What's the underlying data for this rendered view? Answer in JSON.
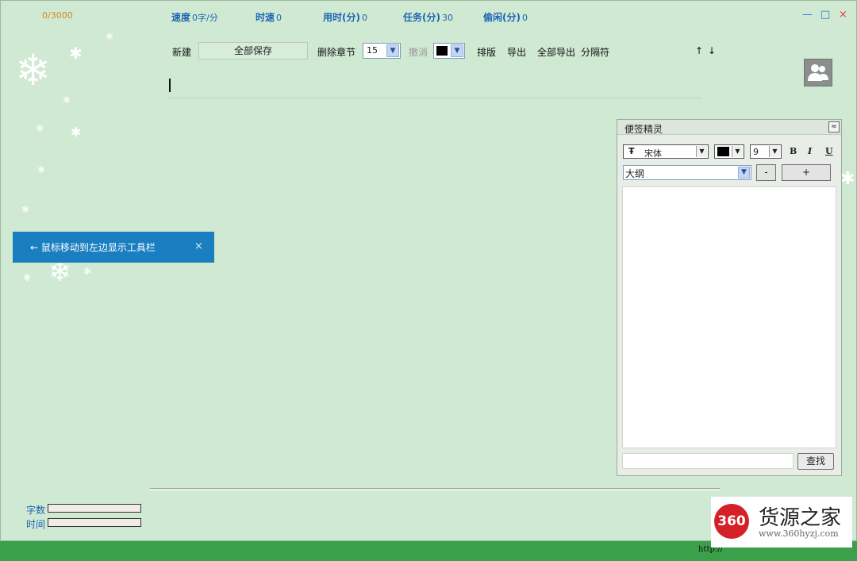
{
  "stats": {
    "word_count": "0/3000",
    "speed_label": "速度",
    "speed_value": "0字/分",
    "hour_speed_label": "时速",
    "hour_speed_value": "0",
    "time_used_label": "用时(分)",
    "time_used_value": "0",
    "task_label": "任务(分)",
    "task_value": "30",
    "idle_label": "偷闲(分)",
    "idle_value": "0"
  },
  "window_controls": {
    "minimize": "—",
    "maximize": "□",
    "close": "×"
  },
  "toolbar": {
    "new_label": "新建",
    "save_all_label": "全部保存",
    "delete_chapter_label": "删除章节",
    "chapter_number": "15",
    "undo_label": "撤消",
    "layout_label": "排版",
    "export_label": "导出",
    "export_all_label": "全部导出",
    "separator_label": "分隔符",
    "up_label": "↑",
    "down_label": "↓",
    "text_color": "#000000"
  },
  "hint": {
    "text": "← 鼠标移动到左边显示工具栏",
    "close": "×"
  },
  "notes_panel": {
    "title": "便签精灵",
    "collapse": "≈",
    "font_icon": "Ŧ",
    "font_name": "宋体",
    "font_color": "#000000",
    "font_size": "9",
    "bold": "B",
    "italic": "I",
    "underline": "U",
    "outline_value": "大纲",
    "minus": "-",
    "plus": "+",
    "search_button": "查找"
  },
  "bottom": {
    "word_count_label": "字数",
    "time_label": "时间"
  },
  "watermark": {
    "logo": "360",
    "name": "货源之家",
    "url": "www.360hyzj.com"
  },
  "colors": {
    "background": "#cfe9d2",
    "accent_blue": "#1c64b4",
    "hint_bg": "#1a7fc1",
    "status_green": "#3aa14a"
  }
}
